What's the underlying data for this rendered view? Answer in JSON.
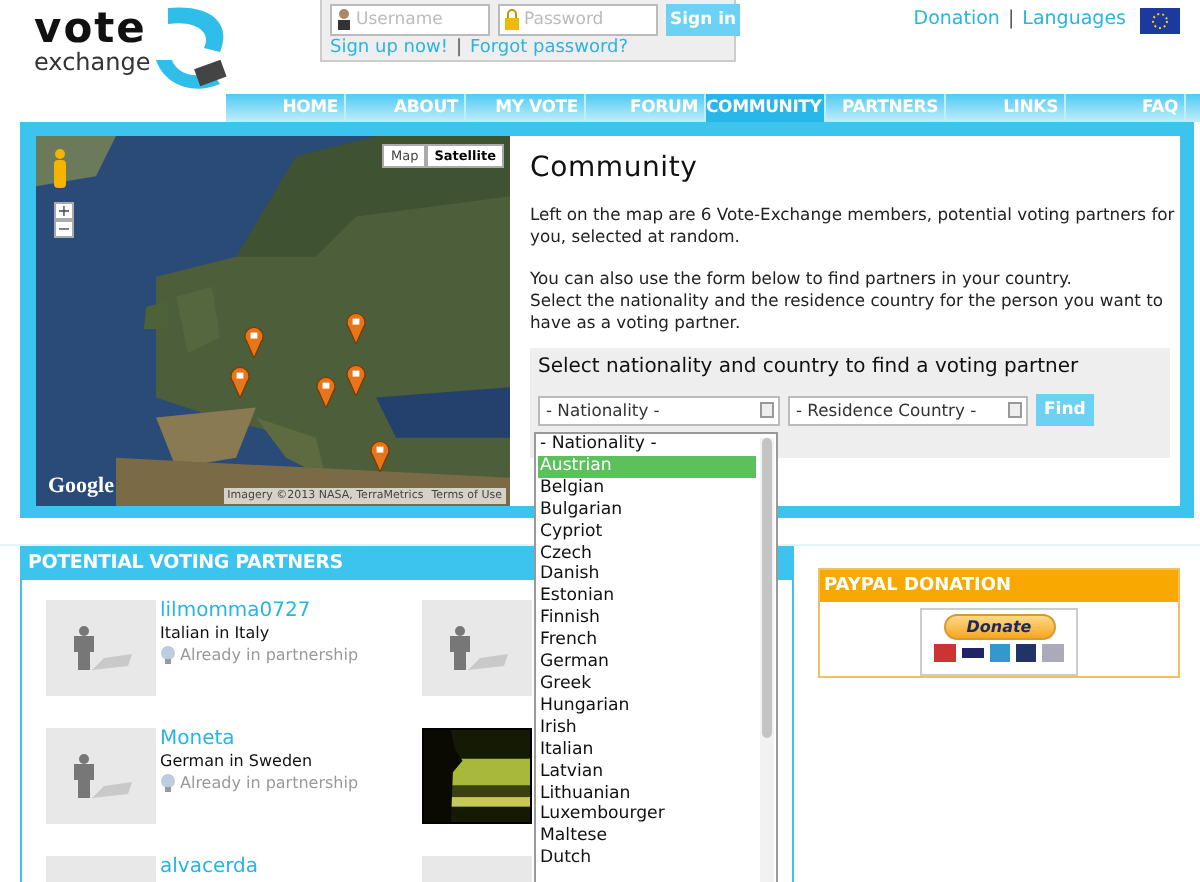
{
  "header": {
    "logo": {
      "top": "vote",
      "bottom": "exchange"
    },
    "login": {
      "username_placeholder": "Username",
      "password_placeholder": "Password",
      "sign_in": "Sign in",
      "signup": "Sign up now!",
      "separator": "|",
      "forgot": "Forgot password?"
    },
    "top_links": {
      "donation": "Donation",
      "separator": "|",
      "languages": "Languages"
    }
  },
  "nav": [
    {
      "label": "HOME",
      "selected": false
    },
    {
      "label": "ABOUT",
      "selected": false
    },
    {
      "label": "MY VOTE",
      "selected": false
    },
    {
      "label": "FORUM",
      "selected": false
    },
    {
      "label": "COMMUNITY",
      "selected": true
    },
    {
      "label": "PARTNERS",
      "selected": false
    },
    {
      "label": "LINKS",
      "selected": false
    },
    {
      "label": "FAQ",
      "selected": false
    }
  ],
  "map": {
    "kind": "picture",
    "type_buttons": [
      {
        "label": "Map",
        "selected": false
      },
      {
        "label": "Satellite",
        "selected": true
      }
    ],
    "zoom_in": "+",
    "zoom_out": "−",
    "logo": "Google",
    "attribution": "Imagery ©2013 NASA, TerraMetrics",
    "terms": "Terms of Use"
  },
  "community": {
    "title": "Community",
    "intro": "Left on the map are 6 Vote-Exchange members, potential voting partners for you, selected at random.",
    "form_text": [
      "You can also use the form below to find partners in your country.",
      "Select the nationality and the residence country for the person you want to have as a voting partner."
    ],
    "form": {
      "title": "Select nationality and country to find a voting partner",
      "nationality": "- Nationality -",
      "residence": "- Residence Country -",
      "find": "Find",
      "options": [
        {
          "label": "- Nationality -",
          "selected": false
        },
        {
          "label": "Austrian",
          "selected": true
        },
        {
          "label": "Belgian",
          "selected": false
        },
        {
          "label": "Bulgarian",
          "selected": false
        },
        {
          "label": "Cypriot",
          "selected": false
        },
        {
          "label": "Czech",
          "selected": false
        },
        {
          "label": "Danish",
          "selected": false
        },
        {
          "label": "Estonian",
          "selected": false
        },
        {
          "label": "Finnish",
          "selected": false
        },
        {
          "label": "French",
          "selected": false
        },
        {
          "label": "German",
          "selected": false
        },
        {
          "label": "Greek",
          "selected": false
        },
        {
          "label": "Hungarian",
          "selected": false
        },
        {
          "label": "Irish",
          "selected": false
        },
        {
          "label": "Italian",
          "selected": false
        },
        {
          "label": "Latvian",
          "selected": false
        },
        {
          "label": "Lithuanian",
          "selected": false
        },
        {
          "label": "Luxembourger",
          "selected": false
        },
        {
          "label": "Maltese",
          "selected": false
        },
        {
          "label": "Dutch",
          "selected": false
        }
      ]
    }
  },
  "partners": {
    "title": "POTENTIAL VOTING PARTNERS",
    "items": [
      {
        "kind": "silhouette",
        "name": "lilmomma0727",
        "detail": "Italian in Italy",
        "status": "Already in partnership"
      },
      {
        "kind": "silhouette"
      },
      {
        "kind": "silhouette",
        "name": "Moneta",
        "detail": "German in Sweden",
        "status": "Already in partnership"
      },
      {
        "kind": "picture"
      },
      {
        "kind": "blank",
        "name": "alvacerda"
      },
      {
        "kind": "blank"
      }
    ]
  },
  "paypal": {
    "title": "PAYPAL DONATION",
    "button": "Donate"
  }
}
